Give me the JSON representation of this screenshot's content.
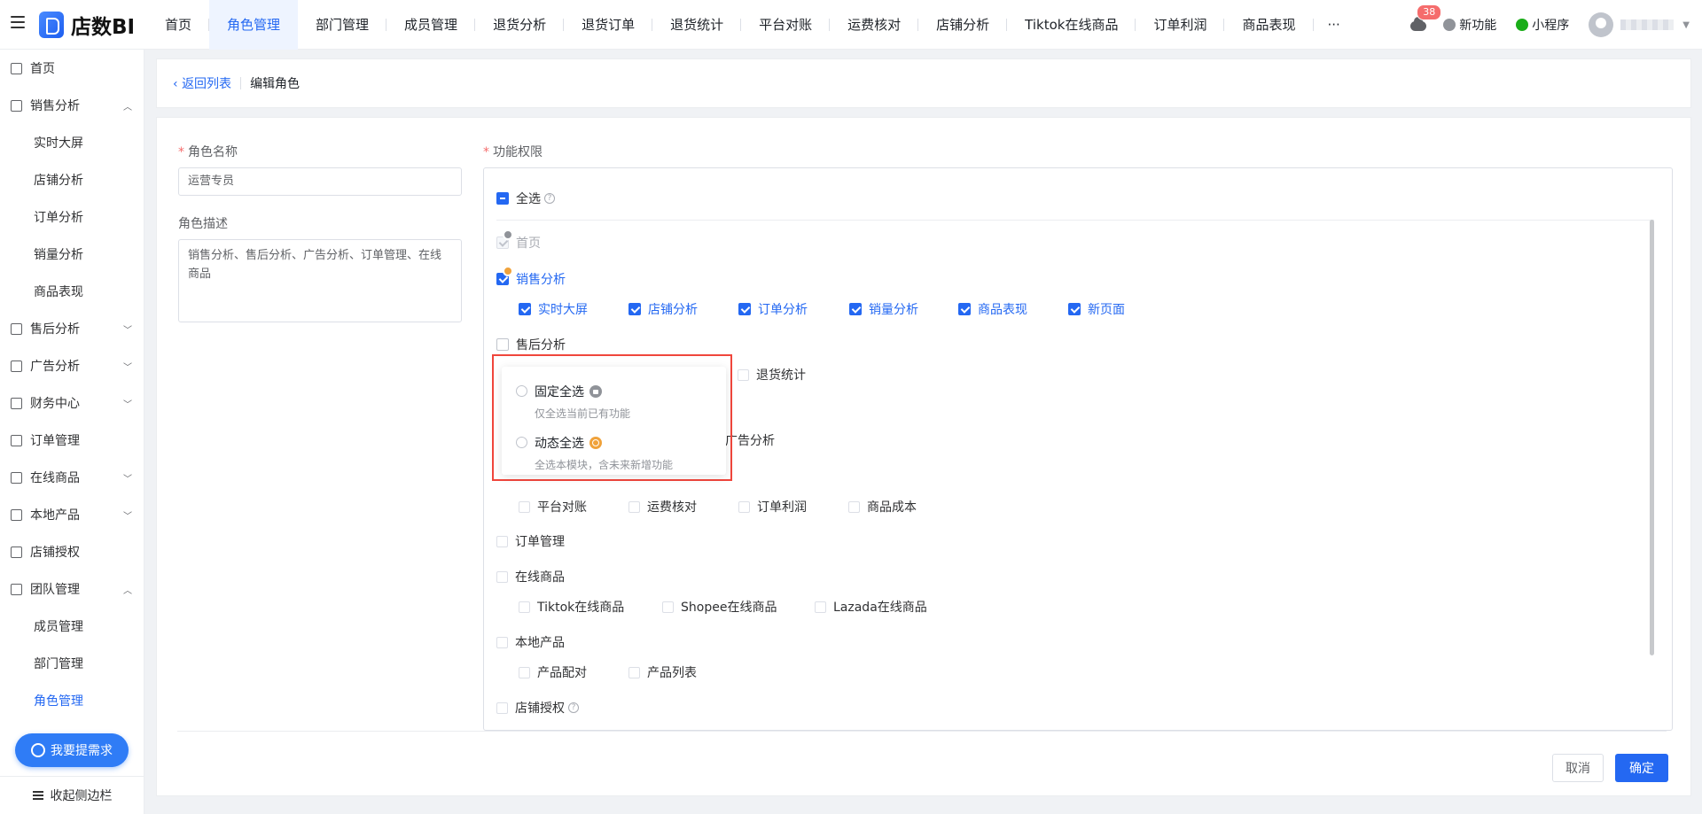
{
  "app": {
    "name": "店数BI"
  },
  "topnav": {
    "tabs": [
      "首页",
      "角色管理",
      "部门管理",
      "成员管理",
      "退货分析",
      "退货订单",
      "退货统计",
      "平台对账",
      "运费核对",
      "店铺分析",
      "Tiktok在线商品",
      "订单利润",
      "商品表现"
    ],
    "more": "···",
    "badge_count": "38",
    "new_feature": "新功能",
    "mini_program": "小程序"
  },
  "sidebar": {
    "items": [
      {
        "label": "首页"
      },
      {
        "label": "销售分析"
      },
      {
        "label": "实时大屏"
      },
      {
        "label": "店铺分析"
      },
      {
        "label": "订单分析"
      },
      {
        "label": "销量分析"
      },
      {
        "label": "商品表现"
      },
      {
        "label": "售后分析"
      },
      {
        "label": "广告分析"
      },
      {
        "label": "财务中心"
      },
      {
        "label": "订单管理"
      },
      {
        "label": "在线商品"
      },
      {
        "label": "本地产品"
      },
      {
        "label": "店铺授权"
      },
      {
        "label": "团队管理"
      },
      {
        "label": "成员管理"
      },
      {
        "label": "部门管理"
      },
      {
        "label": "角色管理"
      }
    ],
    "request_button": "我要提需求",
    "collapse": "收起侧边栏"
  },
  "breadcrumb": {
    "back": "返回列表",
    "current": "编辑角色"
  },
  "form": {
    "role_name_label": "角色名称",
    "role_name_value": "运营专员",
    "role_desc_label": "角色描述",
    "role_desc_value": "销售分析、售后分析、广告分析、订单管理、在线商品",
    "perm_label": "功能权限"
  },
  "perms": {
    "select_all": "全选",
    "home": "首页",
    "sales": "销售分析",
    "sales_children": [
      "实时大屏",
      "店铺分析",
      "订单分析",
      "销量分析",
      "商品表现",
      "新页面"
    ],
    "after_sales": "售后分析",
    "return_stats": "退货统计",
    "ads_partial": "广告分析",
    "finance_children": [
      "平台对账",
      "运费核对",
      "订单利润",
      "商品成本"
    ],
    "order_mgmt": "订单管理",
    "online": "在线商品",
    "online_children": [
      "Tiktok在线商品",
      "Shopee在线商品",
      "Lazada在线商品"
    ],
    "local": "本地产品",
    "local_children": [
      "产品配对",
      "产品列表"
    ],
    "shop_auth": "店铺授权"
  },
  "popup": {
    "fixed_title": "固定全选",
    "fixed_desc": "仅全选当前已有功能",
    "dynamic_title": "动态全选",
    "dynamic_desc": "全选本模块，含未来新增功能"
  },
  "actions": {
    "cancel": "取消",
    "confirm": "确定"
  }
}
